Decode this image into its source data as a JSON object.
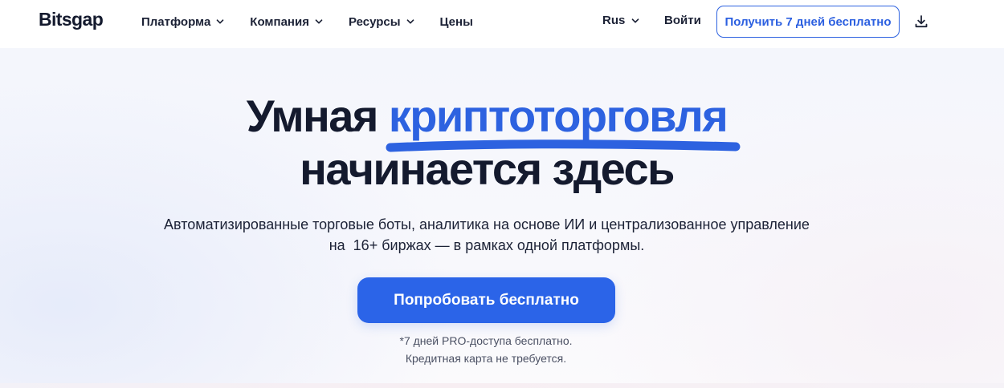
{
  "header": {
    "logo": "Bitsgap",
    "nav": [
      {
        "label": "Платформа",
        "has_dropdown": true
      },
      {
        "label": "Компания",
        "has_dropdown": true
      },
      {
        "label": "Ресурсы",
        "has_dropdown": true
      },
      {
        "label": "Цены",
        "has_dropdown": false
      }
    ],
    "language": "Rus",
    "login_label": "Войти",
    "trial_button_label": "Получить 7 дней бесплатно",
    "download_icon": "download-icon"
  },
  "hero": {
    "title_part1": "Умная ",
    "title_accent": "криптоторговля",
    "title_line2": "начинается здесь",
    "subtitle_line1": "Автоматизированные торговые боты, аналитика на основе ИИ и централизованное управление",
    "subtitle_line2": "на  16+ биржах — в рамках одной платформы.",
    "cta_label": "Попробовать бесплатно",
    "note_line1": "*7 дней PRO-доступа бесплатно.",
    "note_line2": "Кредитная карта не требуется."
  },
  "colors": {
    "accent": "#2d62e0",
    "cta_background": "#2b64e8",
    "text_dark": "#141a2e",
    "note_text": "#4a5063"
  }
}
